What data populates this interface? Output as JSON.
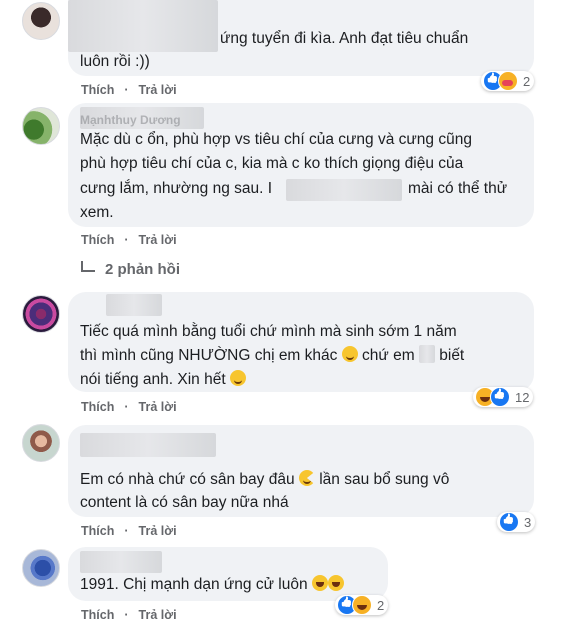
{
  "common": {
    "like": "Thích",
    "reply": "Trả lời",
    "dot": "·"
  },
  "comments": [
    {
      "author": "",
      "lines": [
        "ứng tuyển đi kìa. Anh đạt tiêu chuẩn",
        "luôn rồi :))"
      ],
      "reactions": [
        "like",
        "care"
      ],
      "reaction_count": "2"
    },
    {
      "author": "Mạnhthuy Dương",
      "lines": [
        "Mặc dù c ổn, phù hợp vs tiêu chí của cưng và cưng cũng",
        "phù hợp tiêu chí của c, kia mà c ko thích giọng điệu của",
        "cưng lắm, nhường ng sau. I",
        "mài có thể thử",
        "xem."
      ],
      "replies": "2 phản hồi"
    },
    {
      "author": "",
      "lines": [
        "Tiếc quá mình bằng tuổi chứ mình mà sinh sớm 1 năm",
        "thì mình cũng NHƯỜNG chị em khác",
        "chứ em",
        "biết",
        "nói tiếng anh. Xin hết"
      ],
      "reactions": [
        "haha",
        "like"
      ],
      "reaction_count": "12"
    },
    {
      "author": "",
      "lines": [
        "Em có nhà chứ có sân bay đâu",
        "lần sau bổ sung vô",
        "content là có sân bay nữa nhá"
      ],
      "reactions": [
        "like"
      ],
      "reaction_count": "3"
    },
    {
      "author": "",
      "lines": [
        "1991. Chị mạnh dạn ứng cử luôn"
      ],
      "reactions": [
        "like",
        "haha"
      ],
      "reaction_count": "2"
    }
  ]
}
